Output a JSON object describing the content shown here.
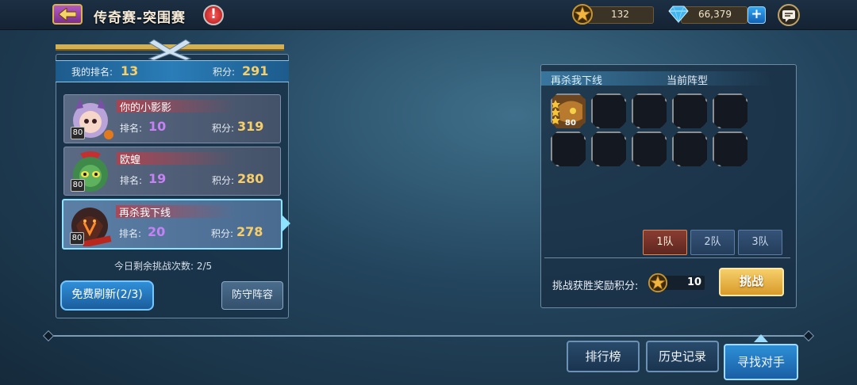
{
  "header": {
    "title": "传奇赛-突围赛",
    "info_mark": "!",
    "star_currency": "132",
    "gems": "66,379",
    "plus_label": "+"
  },
  "my_rank": {
    "rank_label": "我的排名:",
    "rank": "13",
    "score_label": "积分:",
    "score": "291"
  },
  "opponents": [
    {
      "name": "你的小影影",
      "rank_label": "排名:",
      "rank": "10",
      "score_label": "积分:",
      "score": "319",
      "level": "80"
    },
    {
      "name": "欧蝗",
      "rank_label": "排名:",
      "rank": "19",
      "score_label": "积分:",
      "score": "280",
      "level": "80"
    },
    {
      "name": "再杀我下线",
      "rank_label": "排名:",
      "rank": "20",
      "score_label": "积分:",
      "score": "278",
      "level": "80"
    }
  ],
  "remaining": "今日剩余挑战次数: 2/5",
  "buttons": {
    "refresh": "免费刷新(2/3)",
    "defense": "防守阵容",
    "challenge": "挑战",
    "leaderboard": "排行榜",
    "history": "历史记录",
    "find_opponent": "寻找对手"
  },
  "lineup": {
    "player_name": "再杀我下线",
    "formation_label": "当前阵型",
    "hero_level": "80",
    "teams": [
      "1队",
      "2队",
      "3队"
    ],
    "active_team": "1队",
    "reward_label": "挑战获胜奖励积分:",
    "reward_value": "10"
  },
  "colors": {
    "gold": "#f7cf6a",
    "purple": "#c681f5",
    "accent_blue": "#2d8fd6"
  }
}
